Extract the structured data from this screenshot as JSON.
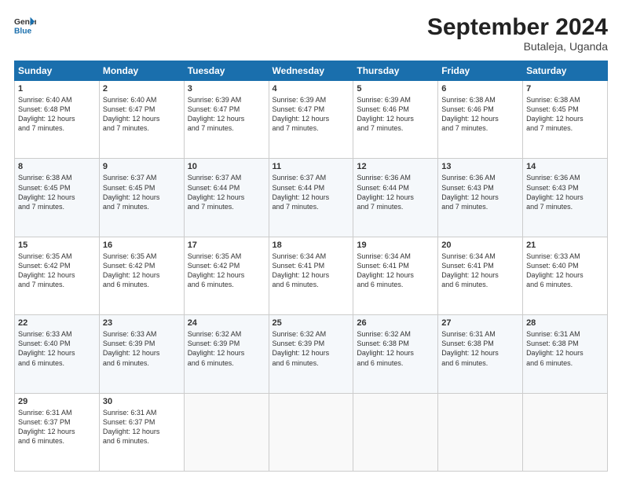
{
  "logo": {
    "line1": "General",
    "line2": "Blue"
  },
  "title": "September 2024",
  "subtitle": "Butaleja, Uganda",
  "days_header": [
    "Sunday",
    "Monday",
    "Tuesday",
    "Wednesday",
    "Thursday",
    "Friday",
    "Saturday"
  ],
  "weeks": [
    [
      {
        "day": "1",
        "info": "Sunrise: 6:40 AM\nSunset: 6:48 PM\nDaylight: 12 hours\nand 7 minutes."
      },
      {
        "day": "2",
        "info": "Sunrise: 6:40 AM\nSunset: 6:47 PM\nDaylight: 12 hours\nand 7 minutes."
      },
      {
        "day": "3",
        "info": "Sunrise: 6:39 AM\nSunset: 6:47 PM\nDaylight: 12 hours\nand 7 minutes."
      },
      {
        "day": "4",
        "info": "Sunrise: 6:39 AM\nSunset: 6:47 PM\nDaylight: 12 hours\nand 7 minutes."
      },
      {
        "day": "5",
        "info": "Sunrise: 6:39 AM\nSunset: 6:46 PM\nDaylight: 12 hours\nand 7 minutes."
      },
      {
        "day": "6",
        "info": "Sunrise: 6:38 AM\nSunset: 6:46 PM\nDaylight: 12 hours\nand 7 minutes."
      },
      {
        "day": "7",
        "info": "Sunrise: 6:38 AM\nSunset: 6:45 PM\nDaylight: 12 hours\nand 7 minutes."
      }
    ],
    [
      {
        "day": "8",
        "info": "Sunrise: 6:38 AM\nSunset: 6:45 PM\nDaylight: 12 hours\nand 7 minutes."
      },
      {
        "day": "9",
        "info": "Sunrise: 6:37 AM\nSunset: 6:45 PM\nDaylight: 12 hours\nand 7 minutes."
      },
      {
        "day": "10",
        "info": "Sunrise: 6:37 AM\nSunset: 6:44 PM\nDaylight: 12 hours\nand 7 minutes."
      },
      {
        "day": "11",
        "info": "Sunrise: 6:37 AM\nSunset: 6:44 PM\nDaylight: 12 hours\nand 7 minutes."
      },
      {
        "day": "12",
        "info": "Sunrise: 6:36 AM\nSunset: 6:44 PM\nDaylight: 12 hours\nand 7 minutes."
      },
      {
        "day": "13",
        "info": "Sunrise: 6:36 AM\nSunset: 6:43 PM\nDaylight: 12 hours\nand 7 minutes."
      },
      {
        "day": "14",
        "info": "Sunrise: 6:36 AM\nSunset: 6:43 PM\nDaylight: 12 hours\nand 7 minutes."
      }
    ],
    [
      {
        "day": "15",
        "info": "Sunrise: 6:35 AM\nSunset: 6:42 PM\nDaylight: 12 hours\nand 7 minutes."
      },
      {
        "day": "16",
        "info": "Sunrise: 6:35 AM\nSunset: 6:42 PM\nDaylight: 12 hours\nand 6 minutes."
      },
      {
        "day": "17",
        "info": "Sunrise: 6:35 AM\nSunset: 6:42 PM\nDaylight: 12 hours\nand 6 minutes."
      },
      {
        "day": "18",
        "info": "Sunrise: 6:34 AM\nSunset: 6:41 PM\nDaylight: 12 hours\nand 6 minutes."
      },
      {
        "day": "19",
        "info": "Sunrise: 6:34 AM\nSunset: 6:41 PM\nDaylight: 12 hours\nand 6 minutes."
      },
      {
        "day": "20",
        "info": "Sunrise: 6:34 AM\nSunset: 6:41 PM\nDaylight: 12 hours\nand 6 minutes."
      },
      {
        "day": "21",
        "info": "Sunrise: 6:33 AM\nSunset: 6:40 PM\nDaylight: 12 hours\nand 6 minutes."
      }
    ],
    [
      {
        "day": "22",
        "info": "Sunrise: 6:33 AM\nSunset: 6:40 PM\nDaylight: 12 hours\nand 6 minutes."
      },
      {
        "day": "23",
        "info": "Sunrise: 6:33 AM\nSunset: 6:39 PM\nDaylight: 12 hours\nand 6 minutes."
      },
      {
        "day": "24",
        "info": "Sunrise: 6:32 AM\nSunset: 6:39 PM\nDaylight: 12 hours\nand 6 minutes."
      },
      {
        "day": "25",
        "info": "Sunrise: 6:32 AM\nSunset: 6:39 PM\nDaylight: 12 hours\nand 6 minutes."
      },
      {
        "day": "26",
        "info": "Sunrise: 6:32 AM\nSunset: 6:38 PM\nDaylight: 12 hours\nand 6 minutes."
      },
      {
        "day": "27",
        "info": "Sunrise: 6:31 AM\nSunset: 6:38 PM\nDaylight: 12 hours\nand 6 minutes."
      },
      {
        "day": "28",
        "info": "Sunrise: 6:31 AM\nSunset: 6:38 PM\nDaylight: 12 hours\nand 6 minutes."
      }
    ],
    [
      {
        "day": "29",
        "info": "Sunrise: 6:31 AM\nSunset: 6:37 PM\nDaylight: 12 hours\nand 6 minutes."
      },
      {
        "day": "30",
        "info": "Sunrise: 6:31 AM\nSunset: 6:37 PM\nDaylight: 12 hours\nand 6 minutes."
      },
      {
        "day": "",
        "info": ""
      },
      {
        "day": "",
        "info": ""
      },
      {
        "day": "",
        "info": ""
      },
      {
        "day": "",
        "info": ""
      },
      {
        "day": "",
        "info": ""
      }
    ]
  ]
}
